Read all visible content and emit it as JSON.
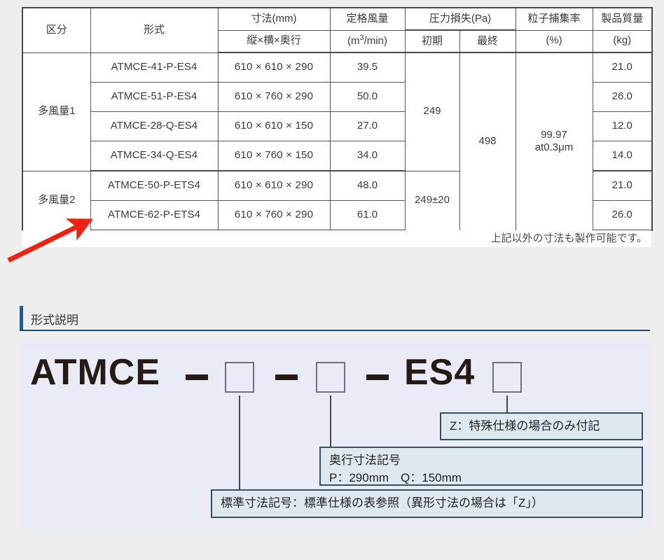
{
  "table": {
    "headers": {
      "category": "区分",
      "model": "形式",
      "dimension_main": "寸法(mm)",
      "dimension_sub": "縦×横×奥行",
      "airflow_main": "定格風量",
      "airflow_sub_pre": "(m",
      "airflow_sub_sup": "3",
      "airflow_sub_post": "/min)",
      "pressure_group": "圧力損失(Pa)",
      "pressure_initial": "初期",
      "pressure_final": "最終",
      "efficiency_main": "粒子捕集率",
      "efficiency_sub": "(%)",
      "mass_main": "製品質量",
      "mass_sub": "(kg)"
    },
    "groups": [
      {
        "category": "多風量1",
        "pressure_initial": "249",
        "rows": [
          {
            "model": "ATMCE-41-P-ES4",
            "dimension": "610 × 610 × 290",
            "airflow": "39.5",
            "mass": "21.0"
          },
          {
            "model": "ATMCE-51-P-ES4",
            "dimension": "610 × 760 × 290",
            "airflow": "50.0",
            "mass": "26.0"
          },
          {
            "model": "ATMCE-28-Q-ES4",
            "dimension": "610 × 610 × 150",
            "airflow": "27.0",
            "mass": "12.0"
          },
          {
            "model": "ATMCE-34-Q-ES4",
            "dimension": "610 × 760 × 150",
            "airflow": "34.0",
            "mass": "14.0"
          }
        ]
      },
      {
        "category": "多風量2",
        "pressure_initial": "249±20",
        "rows": [
          {
            "model": "ATMCE-50-P-ETS4",
            "dimension": "610 × 610 × 290",
            "airflow": "48.0",
            "mass": "21.0"
          },
          {
            "model": "ATMCE-62-P-ETS4",
            "dimension": "610 × 760 × 290",
            "airflow": "61.0",
            "mass": "26.0"
          }
        ]
      }
    ],
    "pressure_final": "498",
    "efficiency_line1": "99.97",
    "efficiency_line2": "at0.3μm",
    "note": "上記以外の寸法も製作可能です。"
  },
  "annotation": {
    "arrow_color": "#ee2211"
  },
  "section": {
    "heading": "形式説明",
    "accent_color": "#1d5c8f"
  },
  "code_diagram": {
    "prefix": "ATMCE",
    "dash1": "—",
    "box1": "",
    "dash2": "—",
    "box2": "",
    "dash3": "—",
    "suffix": "ES4",
    "box3": "",
    "callouts": {
      "z_note": "Z：特殊仕様の場合のみ付記",
      "depth_line1": "奥行寸法記号",
      "depth_line2": "P：290mm　Q：150mm",
      "standard_note": "標準寸法記号：標準仕様の表参照（異形寸法の場合は「Z」）"
    }
  }
}
